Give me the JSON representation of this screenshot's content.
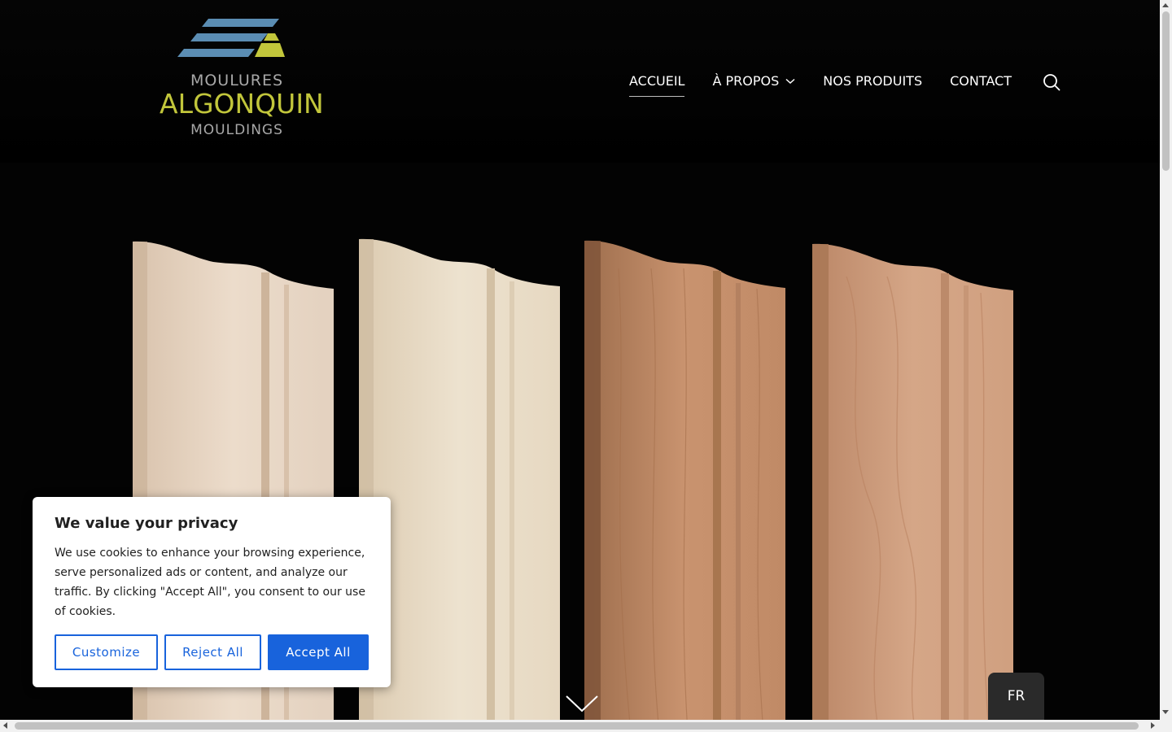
{
  "logo": {
    "line1": "MOULURES",
    "line2": "ALGONQUIN",
    "line3": "MOULDINGS",
    "colors": {
      "blue": "#5b8db3",
      "green": "#c2c63b",
      "gray": "#a8a8a8"
    }
  },
  "nav": {
    "items": [
      {
        "label": "ACCUEIL",
        "active": true
      },
      {
        "label": "À PROPOS",
        "has_dropdown": true
      },
      {
        "label": "NOS PRODUITS"
      },
      {
        "label": "CONTACT"
      }
    ],
    "search_icon": "search-icon"
  },
  "hero": {
    "boards": [
      "maple-moulding",
      "poplar-moulding",
      "oak-moulding",
      "cherry-moulding"
    ]
  },
  "cookie": {
    "title": "We value your privacy",
    "text": "We use cookies to enhance your browsing experience, serve personalized ads or content, and analyze our traffic. By clicking \"Accept All\", you consent to our use of cookies.",
    "customize": "Customize",
    "reject": "Reject All",
    "accept": "Accept All",
    "accent": "#1863dc"
  },
  "language": {
    "label": "FR"
  },
  "scroll_down_icon": "chevron-down-icon"
}
